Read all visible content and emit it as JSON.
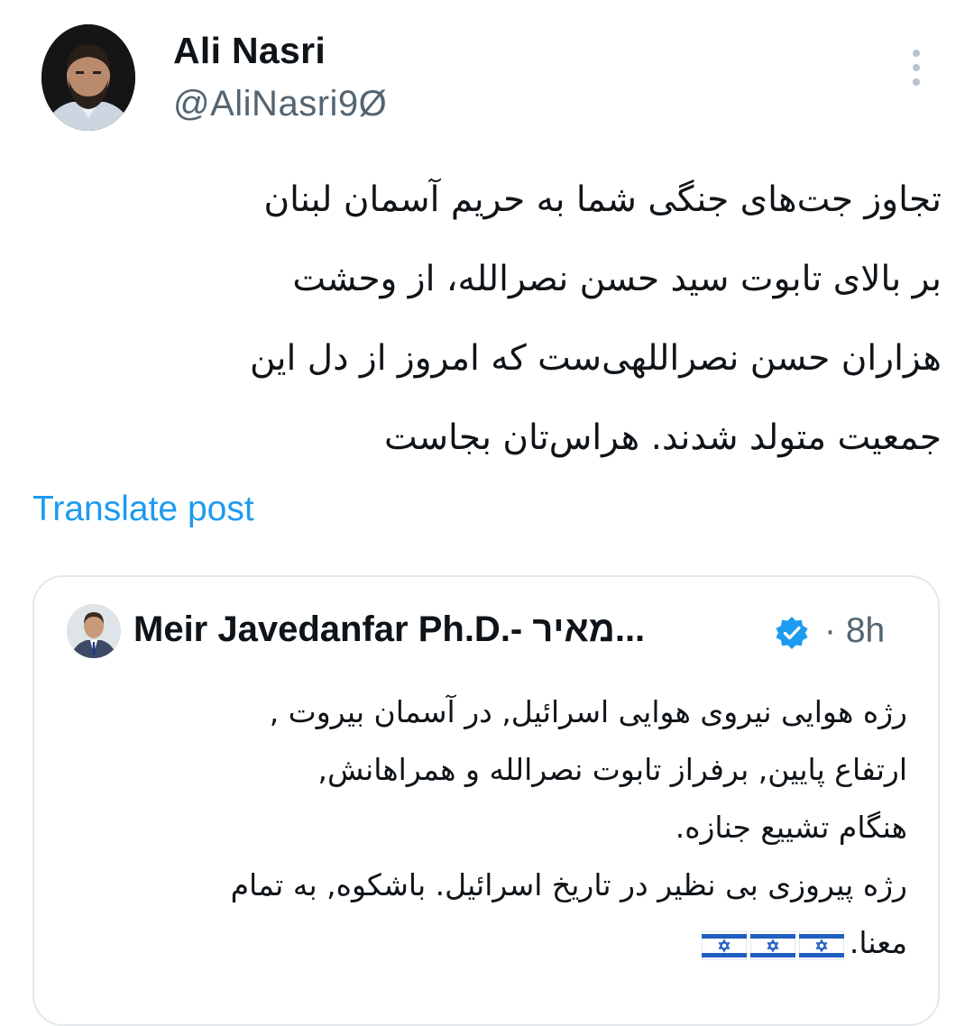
{
  "post": {
    "author": {
      "name": "Ali Nasri",
      "handle": "@AliNasri9Ø"
    },
    "text_lines": [
      "تجاوز جت‌های جنگی شما به حریم آسمان لبنان",
      "بر بالای تابوت سید حسن نصرالله، از وحشت",
      "هزاران حسن نصراللهی‌ست که امروز از دل این",
      "جمعیت متولد شدند. هراس‌تان بجاست"
    ],
    "translate_label": "Translate post",
    "more_icon": "more-vertical-icon"
  },
  "quoted_post": {
    "author_name": "Meir Javedanfar Ph.D.- מאיר...",
    "verified_icon": "verified-badge-icon",
    "time": "· 8h",
    "text_lines": [
      "رژه هوایی نیروی هوایی اسرائیل, در آسمان بیروت ,",
      "ارتفاع پایین, برفراز تابوت  نصرالله و همراهانش,",
      "هنگام تشییع جنازه.",
      "رژه پیروزی بی نظیر در تاریخ اسرائیل. باشکوه, به تمام",
      "معنا."
    ],
    "flags": [
      "israel-flag-icon",
      "israel-flag-icon",
      "israel-flag-icon"
    ]
  },
  "colors": {
    "link": "#1d9bf0",
    "secondary_text": "#536471",
    "border": "#e3e8ec",
    "verified": "#1d9bf0"
  }
}
